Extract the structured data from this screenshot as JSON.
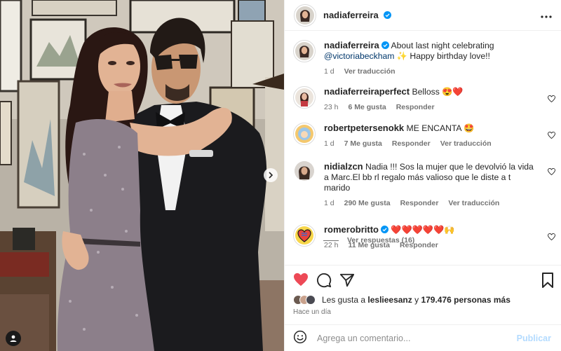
{
  "post": {
    "username": "nadiaferreira",
    "more_icon": "more-horizontal-icon",
    "verified_color": "#0095f6"
  },
  "caption": {
    "username": "nadiaferreira",
    "text_before": "About last night celebrating",
    "mention": "@victoriabeckham",
    "text_after": "✨ Happy birthday love!!",
    "time": "1 d",
    "translate": "Ver traducción"
  },
  "comments": [
    {
      "username": "nadiaferreiraperfect",
      "text": "Belloss 😍❤️",
      "time": "23 h",
      "likes": "6 Me gusta",
      "reply": "Responder",
      "translate": "",
      "avatar_color": "#c9a28d"
    },
    {
      "username": "robertpetersenokk",
      "text": "ME ENCANTA 🤩",
      "time": "1 d",
      "likes": "7 Me gusta",
      "reply": "Responder",
      "translate": "Ver traducción",
      "avatar_color": "#e9b96a"
    },
    {
      "username": "nidialzcn",
      "text": "Nadia !!! Sos la mujer que le devolvió la vida a Marc.El bb rl regalo más valioso que le diste a t marido",
      "time": "1 d",
      "likes": "290 Me gusta",
      "reply": "Responder",
      "translate": "Ver traducción",
      "avatar_color": "#6b5a50"
    },
    {
      "username": "romerobritto",
      "text": "❤️❤️❤️❤️❤️🙌",
      "time": "22 h",
      "likes": "11 Me gusta",
      "reply": "Responder",
      "translate": "",
      "avatar_color": "#e8453c"
    }
  ],
  "view_replies": "Ver respuestas (16)",
  "likes": {
    "prefix": "Les gusta a",
    "user": "leslieesanz",
    "connector": "y",
    "count": "179.476 personas más"
  },
  "posted": "Hace un día",
  "comment_input": {
    "placeholder": "Agrega un comentario...",
    "post_label": "Publicar",
    "emoji_icon": "emoji-icon"
  },
  "colors": {
    "like_red": "#ed4956",
    "mention_blue": "#00376b",
    "secondary_text": "#737373",
    "publish_disabled": "#b3dbff"
  }
}
